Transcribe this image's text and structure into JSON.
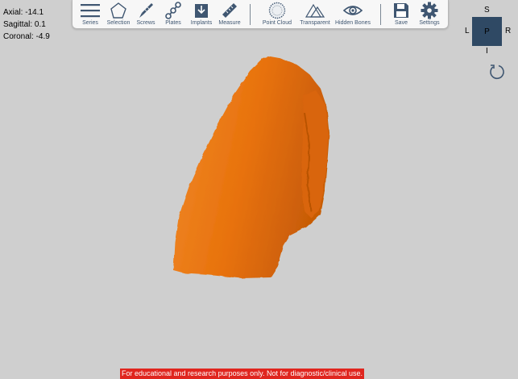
{
  "readouts": {
    "axial": "Axial: -14.1",
    "sagittal": "Sagittal: 0.1",
    "coronal": "Coronal: -4.9"
  },
  "toolbar": {
    "series": "Series",
    "selection": "Selection",
    "screws": "Screws",
    "plates": "Plates",
    "implants": "Implants",
    "measure": "Measure",
    "point_cloud": "Point Cloud",
    "transparent": "Transparent",
    "hidden_bones": "Hidden Bones",
    "save": "Save",
    "settings": "Settings"
  },
  "orientation": {
    "superior": "S",
    "inferior": "I",
    "left": "L",
    "right": "R",
    "current": "P"
  },
  "disclaimer": "For educational and research purposes only. Not for diagnostic/clinical use.",
  "colors": {
    "background": "#cfcfcf",
    "model": "#e8720c",
    "toolbar_icon": "#3f5671",
    "cube": "#2f4964",
    "disclaimer_bg": "#e0261f"
  },
  "icons": {
    "series": "hamburger-menu-icon",
    "selection": "pentagon-icon",
    "screws": "screw-icon",
    "plates": "chain-plate-icon",
    "implants": "download-tray-icon",
    "measure": "ruler-icon",
    "point_cloud": "dotted-sphere-icon",
    "transparent": "overlapping-triangles-icon",
    "hidden_bones": "eye-icon",
    "save": "floppy-disk-icon",
    "settings": "gear-icon",
    "reset_view": "rotate-arrow-icon"
  }
}
